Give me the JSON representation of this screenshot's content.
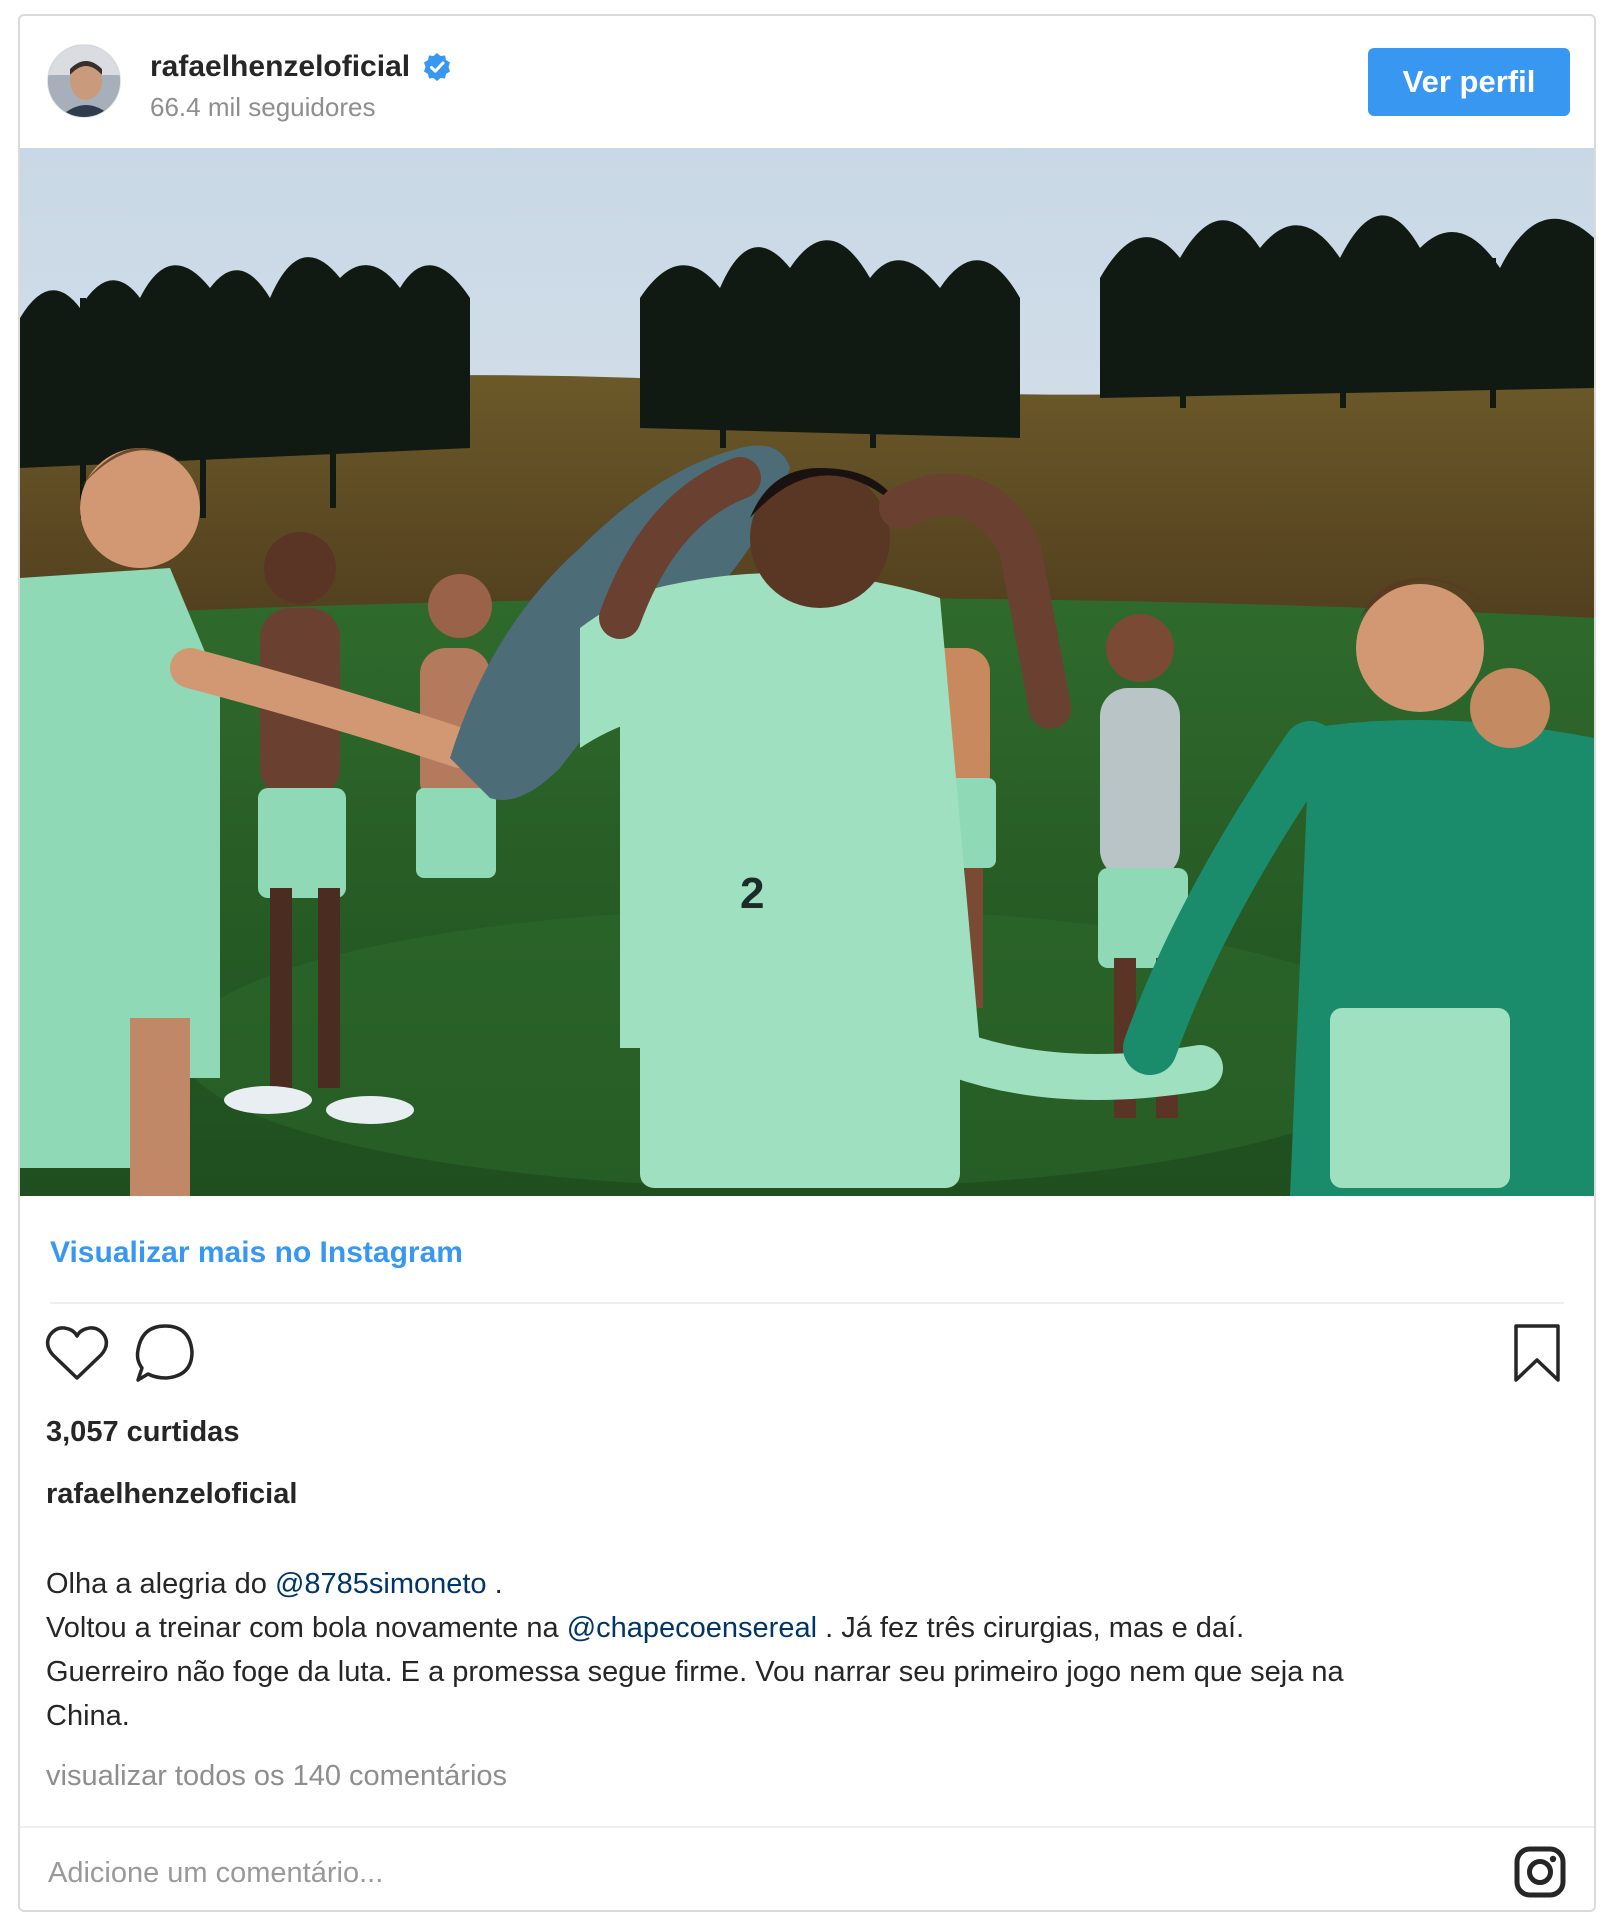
{
  "header": {
    "username": "rafaelhenzeloficial",
    "followers": "66.4 mil seguidores",
    "view_profile_label": "Ver perfil"
  },
  "photo": {
    "description_icon": "photo-image",
    "player_number": "2"
  },
  "more_link": "Visualizar mais no Instagram",
  "actions": {
    "like_icon": "heart-icon",
    "comment_icon": "comment-icon",
    "save_icon": "bookmark-icon"
  },
  "likes": "3,057 curtidas",
  "caption": {
    "username": "rafaelhenzeloficial",
    "line1_pre": "Olha a alegria do ",
    "mention1": "@8785simoneto",
    "line1_post": " .",
    "line2_pre": "Voltou a treinar com bola novamente na ",
    "mention2": "@chapecoensereal",
    "line2_post": " . Já fez três cirurgias, mas e daí.",
    "line3": "Guerreiro não foge da luta. E a promessa segue firme. Vou narrar seu primeiro jogo nem que seja na",
    "line4": "China."
  },
  "comments_link": "visualizar todos os 140 comentários",
  "comment_input": {
    "placeholder": "Adicione um comentário...",
    "value": ""
  },
  "colors": {
    "accent": "#3897f0",
    "text": "#262626",
    "muted": "#8e8e8e",
    "mention": "#003569",
    "kit_green": "#8fd9b6"
  }
}
